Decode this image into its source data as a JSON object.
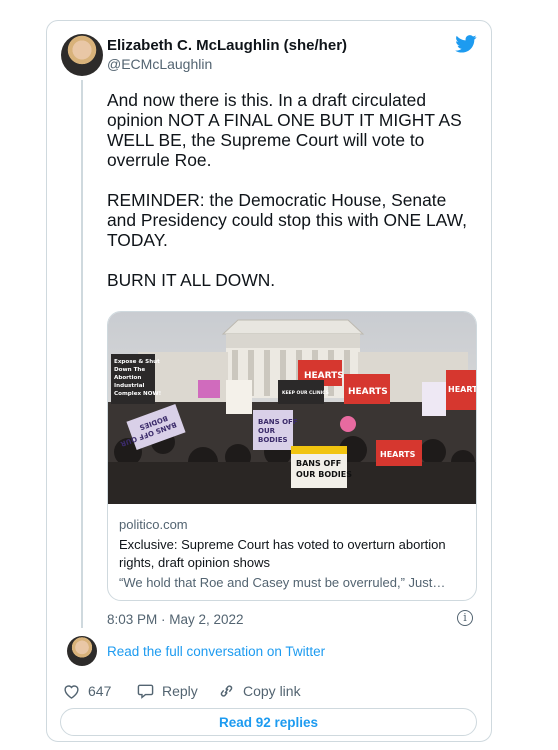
{
  "tweet": {
    "author_name": "Elizabeth C. McLaughlin (she/her)",
    "author_handle": "@ECMcLaughlin",
    "text": "And now there is this. In a draft circulated opinion NOT A FINAL ONE BUT IT MIGHT AS WELL BE, the Supreme Court will vote to overrule Roe.\n\nREMINDER: the Democratic House, Senate and Presidency could stop this with ONE LAW, TODAY.\n\nBURN IT ALL DOWN.",
    "timestamp": "8:03 PM · May 2, 2022"
  },
  "link_card": {
    "domain": "politico.com",
    "title": "Exclusive: Supreme Court has voted to overturn abortion rights, draft opinion shows",
    "description": "“We hold that Roe and Casey must be overruled,” Just…",
    "photo_signs": [
      "Expose & Shut Down The Abortion Industrial Complex NOW!",
      "HEARTS",
      "HEARTS",
      "HEARTS",
      "BANS OFF OUR BODIES",
      "BANS OFF OUR BODIES",
      "BANS OFF OUR BODIES",
      "KEEP OUR CLINICS",
      "HEARTS"
    ]
  },
  "conversation": {
    "read_full_label": "Read the full conversation on Twitter"
  },
  "actions": {
    "like_count": "647",
    "reply_label": "Reply",
    "copy_link_label": "Copy link",
    "read_replies_label": "Read 92 replies"
  },
  "icons": {
    "logo": "twitter-bird-icon",
    "info": "info-icon",
    "like": "heart-icon",
    "reply": "reply-bubble-icon",
    "copy": "link-icon"
  },
  "colors": {
    "accent": "#1d9bf0",
    "text": "#0f1419",
    "muted": "#536471",
    "border": "#cfd9de"
  }
}
